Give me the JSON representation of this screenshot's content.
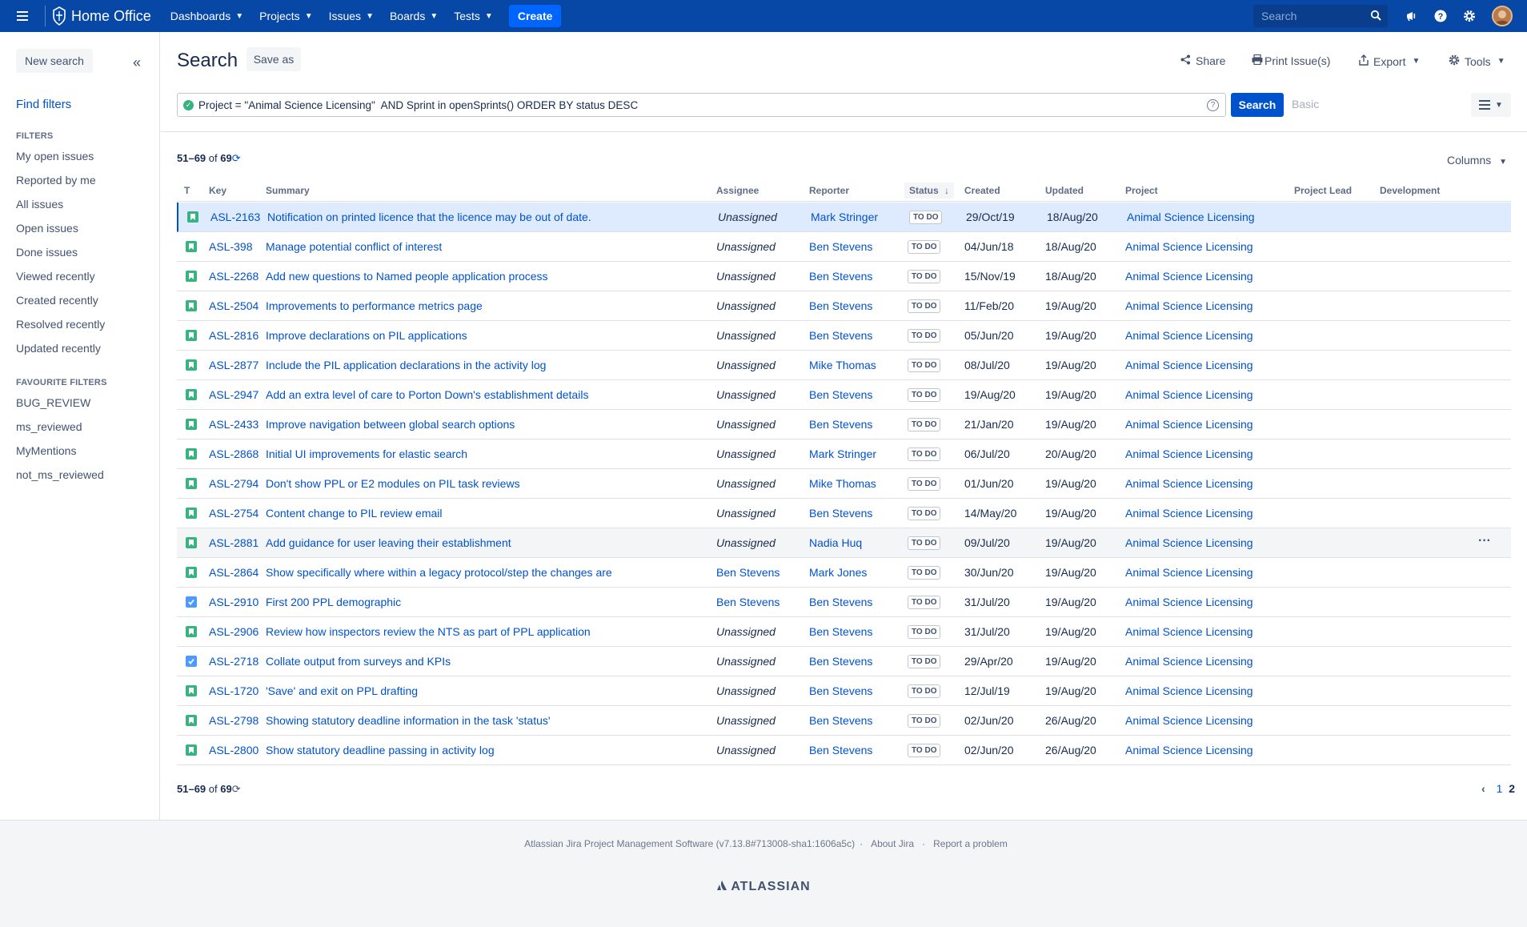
{
  "topnav": {
    "brand": "Home Office",
    "menus": [
      {
        "label": "Dashboards"
      },
      {
        "label": "Projects"
      },
      {
        "label": "Issues"
      },
      {
        "label": "Boards"
      },
      {
        "label": "Tests"
      }
    ],
    "create_label": "Create",
    "search_placeholder": "Search",
    "colors": {
      "bar": "#0747a6",
      "create": "#0065ff"
    }
  },
  "sidebar": {
    "new_search": "New search",
    "find_filters": "Find filters",
    "filters_heading": "FILTERS",
    "filters": [
      "My open issues",
      "Reported by me",
      "All issues",
      "Open issues",
      "Done issues",
      "Viewed recently",
      "Created recently",
      "Resolved recently",
      "Updated recently"
    ],
    "favourites_heading": "FAVOURITE FILTERS",
    "favourites": [
      "BUG_REVIEW",
      "ms_reviewed",
      "MyMentions",
      "not_ms_reviewed"
    ]
  },
  "header": {
    "title": "Search",
    "save_as": "Save as",
    "share": "Share",
    "print": "Print Issue(s)",
    "export": "Export",
    "tools": "Tools"
  },
  "query": {
    "jql": "Project = \"Animal Science Licensing\"  AND Sprint in openSprints() ORDER BY status DESC",
    "search_label": "Search",
    "basic_label": "Basic"
  },
  "results": {
    "range": "51–69",
    "of": "of",
    "total": "69",
    "columns_label": "Columns",
    "headers": {
      "type": "T",
      "key": "Key",
      "summary": "Summary",
      "assignee": "Assignee",
      "reporter": "Reporter",
      "status": "Status",
      "created": "Created",
      "updated": "Updated",
      "project": "Project",
      "project_lead": "Project Lead",
      "development": "Development"
    },
    "rows": [
      {
        "type": "story",
        "key": "ASL-2163",
        "summary": "Notification on printed licence that the licence may be out of date.",
        "assignee": "Unassigned",
        "reporter": "Mark Stringer",
        "status": "TO DO",
        "created": "29/Oct/19",
        "updated": "18/Aug/20",
        "project": "Animal Science Licensing"
      },
      {
        "type": "story",
        "key": "ASL-398",
        "summary": "Manage potential conflict of interest",
        "assignee": "Unassigned",
        "reporter": "Ben Stevens",
        "status": "TO DO",
        "created": "04/Jun/18",
        "updated": "18/Aug/20",
        "project": "Animal Science Licensing"
      },
      {
        "type": "story",
        "key": "ASL-2268",
        "summary": "Add new questions to Named people application process",
        "assignee": "Unassigned",
        "reporter": "Ben Stevens",
        "status": "TO DO",
        "created": "15/Nov/19",
        "updated": "18/Aug/20",
        "project": "Animal Science Licensing"
      },
      {
        "type": "story",
        "key": "ASL-2504",
        "summary": "Improvements to performance metrics page",
        "assignee": "Unassigned",
        "reporter": "Ben Stevens",
        "status": "TO DO",
        "created": "11/Feb/20",
        "updated": "19/Aug/20",
        "project": "Animal Science Licensing"
      },
      {
        "type": "story",
        "key": "ASL-2816",
        "summary": "Improve declarations on PIL applications",
        "assignee": "Unassigned",
        "reporter": "Ben Stevens",
        "status": "TO DO",
        "created": "05/Jun/20",
        "updated": "19/Aug/20",
        "project": "Animal Science Licensing"
      },
      {
        "type": "story",
        "key": "ASL-2877",
        "summary": "Include the PIL application declarations in the activity log",
        "assignee": "Unassigned",
        "reporter": "Mike Thomas",
        "status": "TO DO",
        "created": "08/Jul/20",
        "updated": "19/Aug/20",
        "project": "Animal Science Licensing"
      },
      {
        "type": "story",
        "key": "ASL-2947",
        "summary": "Add an extra level of care to Porton Down's establishment details",
        "assignee": "Unassigned",
        "reporter": "Ben Stevens",
        "status": "TO DO",
        "created": "19/Aug/20",
        "updated": "19/Aug/20",
        "project": "Animal Science Licensing"
      },
      {
        "type": "story",
        "key": "ASL-2433",
        "summary": "Improve navigation between global search options",
        "assignee": "Unassigned",
        "reporter": "Ben Stevens",
        "status": "TO DO",
        "created": "21/Jan/20",
        "updated": "19/Aug/20",
        "project": "Animal Science Licensing"
      },
      {
        "type": "story",
        "key": "ASL-2868",
        "summary": "Initial UI improvements for elastic search",
        "assignee": "Unassigned",
        "reporter": "Mark Stringer",
        "status": "TO DO",
        "created": "06/Jul/20",
        "updated": "20/Aug/20",
        "project": "Animal Science Licensing"
      },
      {
        "type": "story",
        "key": "ASL-2794",
        "summary": "Don't show PPL or E2 modules on PIL task reviews",
        "assignee": "Unassigned",
        "reporter": "Mike Thomas",
        "status": "TO DO",
        "created": "01/Jun/20",
        "updated": "19/Aug/20",
        "project": "Animal Science Licensing"
      },
      {
        "type": "story",
        "key": "ASL-2754",
        "summary": "Content change to PIL review email",
        "assignee": "Unassigned",
        "reporter": "Ben Stevens",
        "status": "TO DO",
        "created": "14/May/20",
        "updated": "19/Aug/20",
        "project": "Animal Science Licensing"
      },
      {
        "type": "story",
        "key": "ASL-2881",
        "summary": "Add guidance for user leaving their establishment",
        "assignee": "Unassigned",
        "reporter": "Nadia Huq",
        "status": "TO DO",
        "created": "09/Jul/20",
        "updated": "19/Aug/20",
        "project": "Animal Science Licensing"
      },
      {
        "type": "story",
        "key": "ASL-2864",
        "summary": "Show specifically where within a legacy protocol/step the changes are",
        "assignee": "Ben Stevens",
        "reporter": "Mark Jones",
        "status": "TO DO",
        "created": "30/Jun/20",
        "updated": "19/Aug/20",
        "project": "Animal Science Licensing"
      },
      {
        "type": "task",
        "key": "ASL-2910",
        "summary": "First 200 PPL demographic",
        "assignee": "Ben Stevens",
        "reporter": "Ben Stevens",
        "status": "TO DO",
        "created": "31/Jul/20",
        "updated": "19/Aug/20",
        "project": "Animal Science Licensing"
      },
      {
        "type": "story",
        "key": "ASL-2906",
        "summary": "Review how inspectors review the NTS as part of PPL application",
        "assignee": "Unassigned",
        "reporter": "Ben Stevens",
        "status": "TO DO",
        "created": "31/Jul/20",
        "updated": "19/Aug/20",
        "project": "Animal Science Licensing"
      },
      {
        "type": "task",
        "key": "ASL-2718",
        "summary": "Collate output from surveys and KPIs",
        "assignee": "Unassigned",
        "reporter": "Ben Stevens",
        "status": "TO DO",
        "created": "29/Apr/20",
        "updated": "19/Aug/20",
        "project": "Animal Science Licensing"
      },
      {
        "type": "story",
        "key": "ASL-1720",
        "summary": "'Save' and exit on PPL drafting",
        "assignee": "Unassigned",
        "reporter": "Ben Stevens",
        "status": "TO DO",
        "created": "12/Jul/19",
        "updated": "19/Aug/20",
        "project": "Animal Science Licensing"
      },
      {
        "type": "story",
        "key": "ASL-2798",
        "summary": "Showing statutory deadline information in the task 'status'",
        "assignee": "Unassigned",
        "reporter": "Ben Stevens",
        "status": "TO DO",
        "created": "02/Jun/20",
        "updated": "26/Aug/20",
        "project": "Animal Science Licensing"
      },
      {
        "type": "story",
        "key": "ASL-2800",
        "summary": "Show statutory deadline passing in activity log",
        "assignee": "Unassigned",
        "reporter": "Ben Stevens",
        "status": "TO DO",
        "created": "02/Jun/20",
        "updated": "26/Aug/20",
        "project": "Animal Science Licensing"
      }
    ],
    "pager": {
      "prev": "‹",
      "pages": [
        "1",
        "2"
      ],
      "current": "2"
    }
  },
  "footer": {
    "software": "Atlassian Jira Project Management Software (v7.13.8#713008-sha1:1606a5c)",
    "about": "About Jira",
    "report": "Report a problem",
    "brand": "ATLASSIAN"
  }
}
